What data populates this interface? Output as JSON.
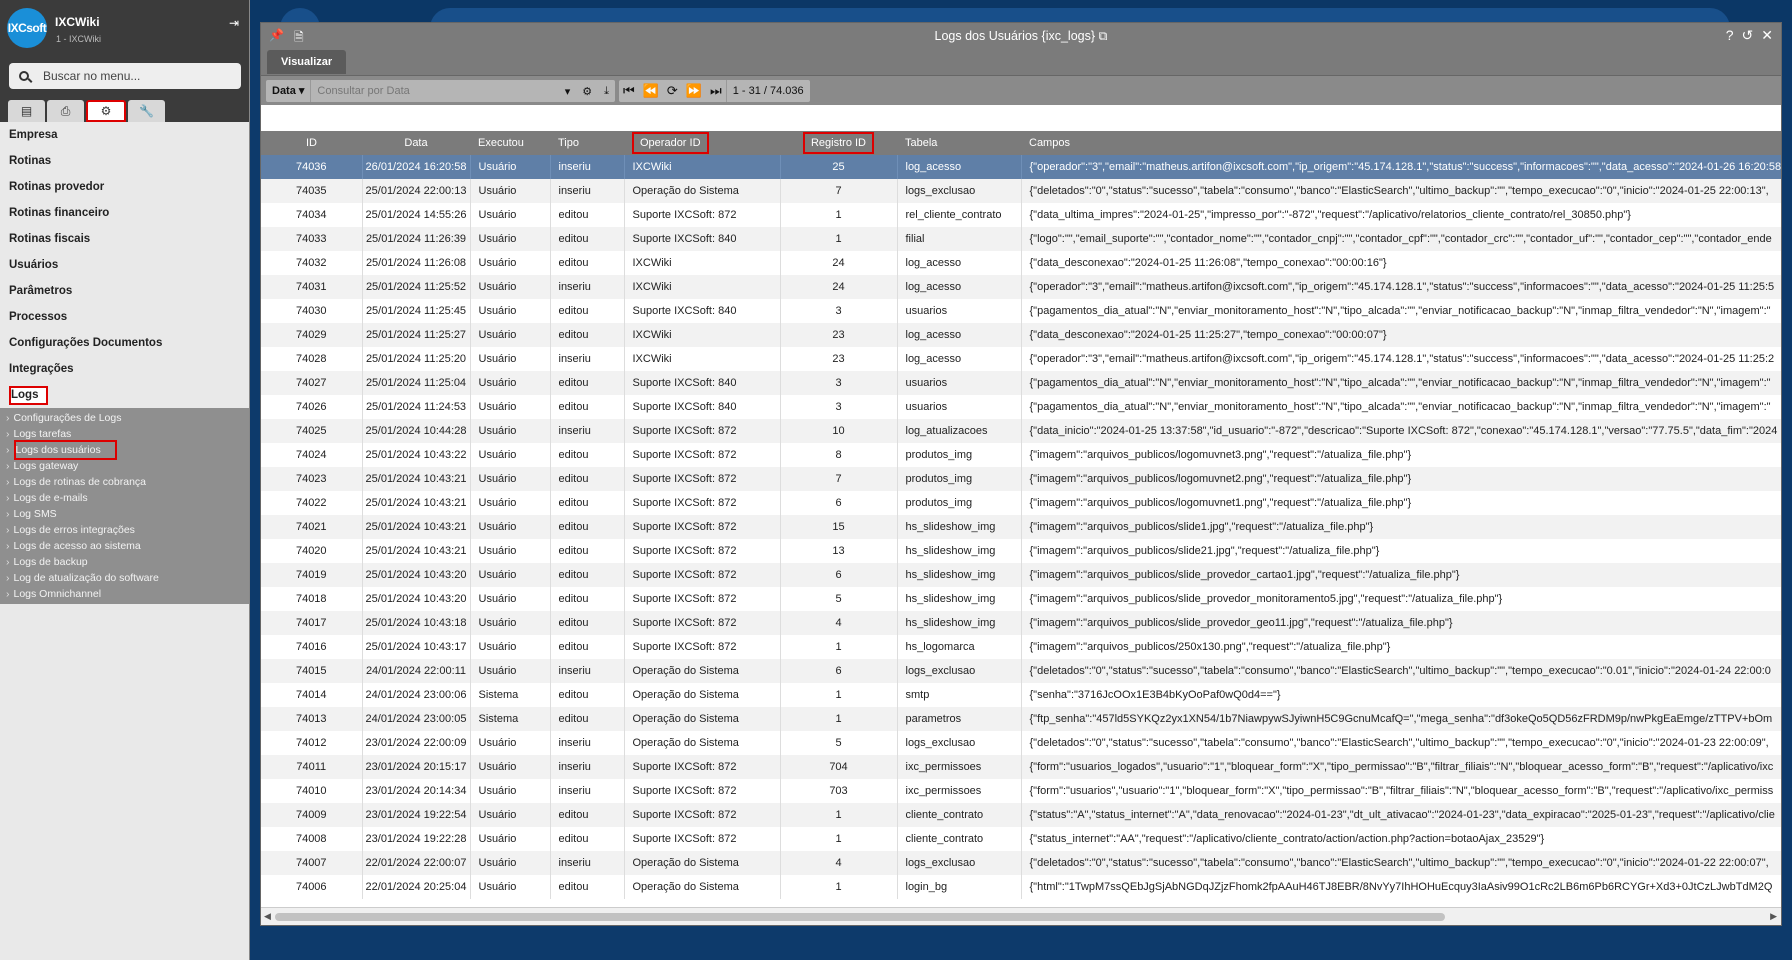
{
  "sidebar": {
    "logo_text": "IXCsoft",
    "app_name": "IXCWiki",
    "app_sub": "1 - IXCWiki",
    "search_placeholder": "Buscar no menu...",
    "menu": [
      "Empresa",
      "Rotinas",
      "Rotinas provedor",
      "Rotinas financeiro",
      "Rotinas fiscais",
      "Usuários",
      "Parâmetros",
      "Processos",
      "Configurações Documentos",
      "Integrações"
    ],
    "selected_menu": "Logs",
    "submenu": [
      "Configurações de Logs",
      "Logs tarefas",
      "Logs dos usuários",
      "Logs gateway",
      "Logs de rotinas de cobrança",
      "Logs de e-mails",
      "Log SMS",
      "Logs de erros integrações",
      "Logs de acesso ao sistema",
      "Logs de backup",
      "Log de atualização do software",
      "Logs Omnichannel"
    ]
  },
  "window": {
    "title": "Logs dos Usuários {ixc_logs}",
    "view_button": "Visualizar",
    "filter_field": "Data",
    "filter_placeholder": "Consultar por Data",
    "page_info": "1 - 31 / 74.036"
  },
  "columns": [
    "ID",
    "Data",
    "Executou",
    "Tipo",
    "Operador ID",
    "Registro ID",
    "Tabela",
    "Campos"
  ],
  "rows": [
    [
      "74036",
      "26/01/2024 16:20:58",
      "Usuário",
      "inseriu",
      "IXCWiki",
      "25",
      "log_acesso",
      "{\"operador\":\"3\",\"email\":\"matheus.artifon@ixcsoft.com\",\"ip_origem\":\"45.174.128.1\",\"status\":\"success\",\"informacoes\":\"\",\"data_acesso\":\"2024-01-26 16:20:58"
    ],
    [
      "74035",
      "25/01/2024 22:00:13",
      "Usuário",
      "inseriu",
      "Operação do Sistema",
      "7",
      "logs_exclusao",
      "{\"deletados\":\"0\",\"status\":\"sucesso\",\"tabela\":\"consumo\",\"banco\":\"ElasticSearch\",\"ultimo_backup\":\"\",\"tempo_execucao\":\"0\",\"inicio\":\"2024-01-25 22:00:13\","
    ],
    [
      "74034",
      "25/01/2024 14:55:26",
      "Usuário",
      "editou",
      "Suporte IXCSoft: 872",
      "1",
      "rel_cliente_contrato",
      "{\"data_ultima_impres\":\"2024-01-25\",\"impresso_por\":\"-872\",\"request\":\"/aplicativo/relatorios_cliente_contrato/rel_30850.php\"}"
    ],
    [
      "74033",
      "25/01/2024 11:26:39",
      "Usuário",
      "editou",
      "Suporte IXCSoft: 840",
      "1",
      "filial",
      "{\"logo\":\"\",\"email_suporte\":\"\",\"contador_nome\":\"\",\"contador_cnpj\":\"\",\"contador_cpf\":\"\",\"contador_crc\":\"\",\"contador_uf\":\"\",\"contador_cep\":\"\",\"contador_ende"
    ],
    [
      "74032",
      "25/01/2024 11:26:08",
      "Usuário",
      "editou",
      "IXCWiki",
      "24",
      "log_acesso",
      "{\"data_desconexao\":\"2024-01-25 11:26:08\",\"tempo_conexao\":\"00:00:16\"}"
    ],
    [
      "74031",
      "25/01/2024 11:25:52",
      "Usuário",
      "inseriu",
      "IXCWiki",
      "24",
      "log_acesso",
      "{\"operador\":\"3\",\"email\":\"matheus.artifon@ixcsoft.com\",\"ip_origem\":\"45.174.128.1\",\"status\":\"success\",\"informacoes\":\"\",\"data_acesso\":\"2024-01-25 11:25:5"
    ],
    [
      "74030",
      "25/01/2024 11:25:45",
      "Usuário",
      "editou",
      "Suporte IXCSoft: 840",
      "3",
      "usuarios",
      "{\"pagamentos_dia_atual\":\"N\",\"enviar_monitoramento_host\":\"N\",\"tipo_alcada\":\"\",\"enviar_notificacao_backup\":\"N\",\"inmap_filtra_vendedor\":\"N\",\"imagem\":\""
    ],
    [
      "74029",
      "25/01/2024 11:25:27",
      "Usuário",
      "editou",
      "IXCWiki",
      "23",
      "log_acesso",
      "{\"data_desconexao\":\"2024-01-25 11:25:27\",\"tempo_conexao\":\"00:00:07\"}"
    ],
    [
      "74028",
      "25/01/2024 11:25:20",
      "Usuário",
      "inseriu",
      "IXCWiki",
      "23",
      "log_acesso",
      "{\"operador\":\"3\",\"email\":\"matheus.artifon@ixcsoft.com\",\"ip_origem\":\"45.174.128.1\",\"status\":\"success\",\"informacoes\":\"\",\"data_acesso\":\"2024-01-25 11:25:2"
    ],
    [
      "74027",
      "25/01/2024 11:25:04",
      "Usuário",
      "editou",
      "Suporte IXCSoft: 840",
      "3",
      "usuarios",
      "{\"pagamentos_dia_atual\":\"N\",\"enviar_monitoramento_host\":\"N\",\"tipo_alcada\":\"\",\"enviar_notificacao_backup\":\"N\",\"inmap_filtra_vendedor\":\"N\",\"imagem\":\""
    ],
    [
      "74026",
      "25/01/2024 11:24:53",
      "Usuário",
      "editou",
      "Suporte IXCSoft: 840",
      "3",
      "usuarios",
      "{\"pagamentos_dia_atual\":\"N\",\"enviar_monitoramento_host\":\"N\",\"tipo_alcada\":\"\",\"enviar_notificacao_backup\":\"N\",\"inmap_filtra_vendedor\":\"N\",\"imagem\":\""
    ],
    [
      "74025",
      "25/01/2024 10:44:28",
      "Usuário",
      "inseriu",
      "Suporte IXCSoft: 872",
      "10",
      "log_atualizacoes",
      "{\"data_inicio\":\"2024-01-25 13:37:58\",\"id_usuario\":\"-872\",\"descricao\":\"Suporte IXCSoft: 872\",\"conexao\":\"45.174.128.1\",\"versao\":\"77.75.5\",\"data_fim\":\"2024"
    ],
    [
      "74024",
      "25/01/2024 10:43:22",
      "Usuário",
      "editou",
      "Suporte IXCSoft: 872",
      "8",
      "produtos_img",
      "{\"imagem\":\"arquivos_publicos/logomuvnet3.png\",\"request\":\"/atualiza_file.php\"}"
    ],
    [
      "74023",
      "25/01/2024 10:43:21",
      "Usuário",
      "editou",
      "Suporte IXCSoft: 872",
      "7",
      "produtos_img",
      "{\"imagem\":\"arquivos_publicos/logomuvnet2.png\",\"request\":\"/atualiza_file.php\"}"
    ],
    [
      "74022",
      "25/01/2024 10:43:21",
      "Usuário",
      "editou",
      "Suporte IXCSoft: 872",
      "6",
      "produtos_img",
      "{\"imagem\":\"arquivos_publicos/logomuvnet1.png\",\"request\":\"/atualiza_file.php\"}"
    ],
    [
      "74021",
      "25/01/2024 10:43:21",
      "Usuário",
      "editou",
      "Suporte IXCSoft: 872",
      "15",
      "hs_slideshow_img",
      "{\"imagem\":\"arquivos_publicos/slide1.jpg\",\"request\":\"/atualiza_file.php\"}"
    ],
    [
      "74020",
      "25/01/2024 10:43:21",
      "Usuário",
      "editou",
      "Suporte IXCSoft: 872",
      "13",
      "hs_slideshow_img",
      "{\"imagem\":\"arquivos_publicos/slide21.jpg\",\"request\":\"/atualiza_file.php\"}"
    ],
    [
      "74019",
      "25/01/2024 10:43:20",
      "Usuário",
      "editou",
      "Suporte IXCSoft: 872",
      "6",
      "hs_slideshow_img",
      "{\"imagem\":\"arquivos_publicos/slide_provedor_cartao1.jpg\",\"request\":\"/atualiza_file.php\"}"
    ],
    [
      "74018",
      "25/01/2024 10:43:20",
      "Usuário",
      "editou",
      "Suporte IXCSoft: 872",
      "5",
      "hs_slideshow_img",
      "{\"imagem\":\"arquivos_publicos/slide_provedor_monitoramento5.jpg\",\"request\":\"/atualiza_file.php\"}"
    ],
    [
      "74017",
      "25/01/2024 10:43:18",
      "Usuário",
      "editou",
      "Suporte IXCSoft: 872",
      "4",
      "hs_slideshow_img",
      "{\"imagem\":\"arquivos_publicos/slide_provedor_geo11.jpg\",\"request\":\"/atualiza_file.php\"}"
    ],
    [
      "74016",
      "25/01/2024 10:43:17",
      "Usuário",
      "editou",
      "Suporte IXCSoft: 872",
      "1",
      "hs_logomarca",
      "{\"imagem\":\"arquivos_publicos/250x130.png\",\"request\":\"/atualiza_file.php\"}"
    ],
    [
      "74015",
      "24/01/2024 22:00:11",
      "Usuário",
      "inseriu",
      "Operação do Sistema",
      "6",
      "logs_exclusao",
      "{\"deletados\":\"0\",\"status\":\"sucesso\",\"tabela\":\"consumo\",\"banco\":\"ElasticSearch\",\"ultimo_backup\":\"\",\"tempo_execucao\":\"0.01\",\"inicio\":\"2024-01-24 22:00:0"
    ],
    [
      "74014",
      "24/01/2024 23:00:06",
      "Sistema",
      "editou",
      "Operação do Sistema",
      "1",
      "smtp",
      "{\"senha\":\"3716JcOOx1E3B4bKyOoPaf0wQ0d4==\"}"
    ],
    [
      "74013",
      "24/01/2024 23:00:05",
      "Sistema",
      "editou",
      "Operação do Sistema",
      "1",
      "parametros",
      "{\"ftp_senha\":\"457ld5SYKQz2yx1XN54/1b7NiawpywSJyiwnH5C9GcnuMcafQ=\",\"mega_senha\":\"df3okeQo5QD56zFRDM9p/nwPkgEaEmge/zTTPV+bOm"
    ],
    [
      "74012",
      "23/01/2024 22:00:09",
      "Usuário",
      "inseriu",
      "Operação do Sistema",
      "5",
      "logs_exclusao",
      "{\"deletados\":\"0\",\"status\":\"sucesso\",\"tabela\":\"consumo\",\"banco\":\"ElasticSearch\",\"ultimo_backup\":\"\",\"tempo_execucao\":\"0\",\"inicio\":\"2024-01-23 22:00:09\","
    ],
    [
      "74011",
      "23/01/2024 20:15:17",
      "Usuário",
      "inseriu",
      "Suporte IXCSoft: 872",
      "704",
      "ixc_permissoes",
      "{\"form\":\"usuarios_logados\",\"usuario\":\"1\",\"bloquear_form\":\"X\",\"tipo_permissao\":\"B\",\"filtrar_filiais\":\"N\",\"bloquear_acesso_form\":\"B\",\"request\":\"/aplicativo/ixc"
    ],
    [
      "74010",
      "23/01/2024 20:14:34",
      "Usuário",
      "inseriu",
      "Suporte IXCSoft: 872",
      "703",
      "ixc_permissoes",
      "{\"form\":\"usuarios\",\"usuario\":\"1\",\"bloquear_form\":\"X\",\"tipo_permissao\":\"B\",\"filtrar_filiais\":\"N\",\"bloquear_acesso_form\":\"B\",\"request\":\"/aplicativo/ixc_permiss"
    ],
    [
      "74009",
      "23/01/2024 19:22:54",
      "Usuário",
      "editou",
      "Suporte IXCSoft: 872",
      "1",
      "cliente_contrato",
      "{\"status\":\"A\",\"status_internet\":\"A\",\"data_renovacao\":\"2024-01-23\",\"dt_ult_ativacao\":\"2024-01-23\",\"data_expiracao\":\"2025-01-23\",\"request\":\"/aplicativo/clie"
    ],
    [
      "74008",
      "23/01/2024 19:22:28",
      "Usuário",
      "editou",
      "Suporte IXCSoft: 872",
      "1",
      "cliente_contrato",
      "{\"status_internet\":\"AA\",\"request\":\"/aplicativo/cliente_contrato/action/action.php?action=botaoAjax_23529\"}"
    ],
    [
      "74007",
      "22/01/2024 22:00:07",
      "Usuário",
      "inseriu",
      "Operação do Sistema",
      "4",
      "logs_exclusao",
      "{\"deletados\":\"0\",\"status\":\"sucesso\",\"tabela\":\"consumo\",\"banco\":\"ElasticSearch\",\"ultimo_backup\":\"\",\"tempo_execucao\":\"0\",\"inicio\":\"2024-01-22 22:00:07\","
    ],
    [
      "74006",
      "22/01/2024 20:25:04",
      "Usuário",
      "editou",
      "Operação do Sistema",
      "1",
      "login_bg",
      "{\"html\":\"1TwpM7ssQEbJgSjAbNGDqJZjzFhomk2fpAAuH46TJ8EBR/8NvYy7IhHOHuEcquy3IaAsiv99O1cRc2LB6m6Pb6RCYGr+Xd3+0JtCzLJwbTdM2Q"
    ]
  ]
}
